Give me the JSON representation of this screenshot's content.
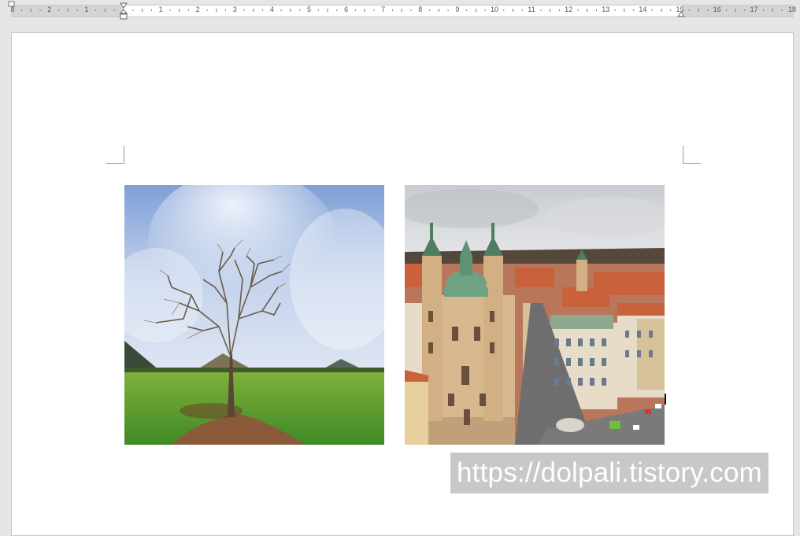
{
  "ruler": {
    "labels": [
      "8",
      "2",
      "1",
      "",
      "1",
      "2",
      "3",
      "4",
      "5",
      "6",
      "7",
      "8",
      "9",
      "10",
      "11",
      "12",
      "13",
      "14",
      "15",
      "16",
      "17",
      "18"
    ]
  },
  "document": {
    "images": [
      {
        "name": "tree-photo",
        "description_icon": "image-icon"
      },
      {
        "name": "prague-church-photo",
        "description_icon": "image-icon"
      }
    ],
    "watermark_text": "https://dolpali.tistory.com"
  },
  "colors": {
    "page": "#ffffff",
    "app_background": "#e6e6e6",
    "watermark_bg": "#bebebe"
  }
}
